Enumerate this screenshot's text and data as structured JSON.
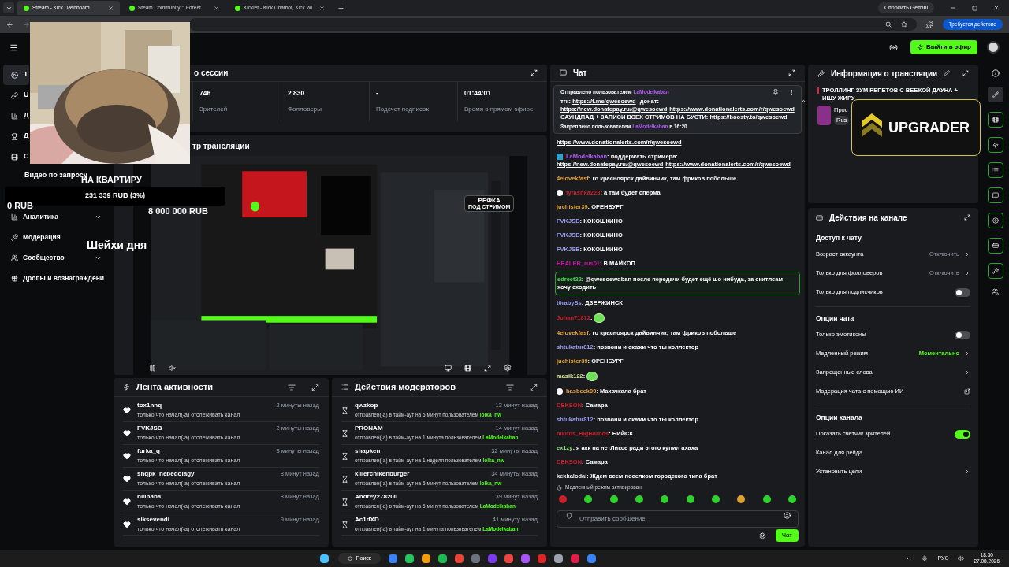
{
  "browser": {
    "tabs": [
      {
        "title": "Stream - Kick Dashboard",
        "selected": true
      },
      {
        "title": "Steam Community :: Edreet",
        "selected": false
      },
      {
        "title": "Kicklet - Kick Chatbot, Kick Wi",
        "selected": false
      }
    ],
    "gemini": "Спросить Gemini",
    "action": "Требуется действие"
  },
  "header": {
    "go_live": "Выйти в эфир"
  },
  "sidebar": {
    "items": [
      {
        "label": "Т",
        "selected": true
      },
      {
        "label": "U",
        "selected": false
      },
      {
        "label": "Д",
        "selected": false
      },
      {
        "label": "Д",
        "selected": false
      },
      {
        "label": "С",
        "selected": false
      }
    ],
    "lower_items": [
      {
        "label": "Аналитика",
        "selected": false,
        "expandable": true
      },
      {
        "label": "Модерация",
        "selected": false,
        "expandable": false
      },
      {
        "label": "Сообщество",
        "selected": false,
        "expandable": true
      },
      {
        "label": "Дропы и вознаграждени",
        "selected": false,
        "expandable": false
      }
    ]
  },
  "session": {
    "title": "о сессии",
    "stats": [
      {
        "value": "746",
        "label": "Зрителей"
      },
      {
        "value": "2 830",
        "label": "Фолловеры"
      },
      {
        "value": "-",
        "label": "Подсчет подписок"
      },
      {
        "value": "01:44:01",
        "label": "Время в прямом эфире"
      }
    ]
  },
  "preview": {
    "title": "тр трансляции",
    "badge_line_1": "РЕФКА",
    "badge_line_2": "ПОД СТРИМОМ"
  },
  "activity": {
    "title": "Лента активности",
    "items": [
      {
        "user": "tox1nnq",
        "time": "2 минуты назад",
        "text": "только что начал(-а) отслеживать канал"
      },
      {
        "user": "FVKJSB",
        "time": "2 минуты назад",
        "text": "только что начал(-а) отслеживать канал"
      },
      {
        "user": "furka_q",
        "time": "3 минуты назад",
        "text": "только что начал(-а) отслеживать канал"
      },
      {
        "user": "snqpk_nebedolagy",
        "time": "8 минут назад",
        "text": "только что начал(-а) отслеживать канал"
      },
      {
        "user": "bilibaba",
        "time": "8 минут назад",
        "text": "только что начал(-а) отслеживать канал"
      },
      {
        "user": "siksevendi",
        "time": "9 минут назад",
        "text": "только что начал(-а) отслеживать канал"
      }
    ]
  },
  "mod_actions": {
    "title": "Действия модераторов",
    "items": [
      {
        "user": "qwzkop",
        "time": "13 минут назад",
        "text": "отправлен(-а) в тайм-аут на 5 минут пользователем",
        "moderator": "lolka_nw"
      },
      {
        "user": "PRONAM",
        "time": "14 минут назад",
        "text": "отправлен(-а) в тайм-аут на 1 минута пользователем",
        "moderator": "LaModelkaban"
      },
      {
        "user": "shapken",
        "time": "32 минуты назад",
        "text": "отправлен(-а) в тайм-аут на 1 неделя пользователем",
        "moderator": "lolka_nw"
      },
      {
        "user": "killerchikenburger",
        "time": "34 минуты назад",
        "text": "отправлен(-а) в тайм-аут на 5 минут пользователем",
        "moderator": "lolka_nw"
      },
      {
        "user": "Andrey278200",
        "time": "39 минут назад",
        "text": "отправлен(-а) в тайм-аут на 5 минут пользователем",
        "moderator": "LaModelkaban"
      },
      {
        "user": "Ac1dXD",
        "time": "41 минуту назад",
        "text": "отправлен(-а) в тайм-аут на 1 минута пользователем",
        "moderator": "LaModelkaban"
      }
    ]
  },
  "chat": {
    "title": "Чат",
    "pinned": {
      "sender_label": "Отправлено пользователем",
      "sender": "LaModelkaban",
      "body": [
        {
          "text": "тгк: ",
          "link": false
        },
        {
          "text": "https://t.me/qwesoewd",
          "link": true
        },
        {
          "text": " донат: ",
          "link": false
        },
        {
          "text": "https://new.donatepay.ru/@qwesoewd",
          "link": true
        },
        {
          "text": "https://www.donationalerts.com/r/qwesoewd",
          "link": true
        },
        {
          "text": " САУНДПАД + ЗАПИСИ ВСЕХ СТРИМОВ НА БУСТИ: ",
          "link": false
        },
        {
          "text": "https://boosty.to/qwesoewd",
          "link": true
        }
      ],
      "footer_label": "Закреплено пользователем",
      "footer_user": "LaModelkaban",
      "footer_time": "в 16:20"
    },
    "messages": [
      {
        "kind": "links",
        "moderator": false,
        "badge": false,
        "highlighted": false,
        "body": [
          {
            "text": "https://www.donationalerts.com/r/qwesoewd",
            "link": true
          }
        ]
      },
      {
        "kind": "links",
        "user": "LaModelkaban",
        "color": "#b05cf0",
        "moderator": true,
        "badge": false,
        "highlighted": false,
        "body": [
          {
            "text": ": поддержать стримера: ",
            "link": false
          },
          {
            "text": "https://new.donatepay.ru/@qwesoewd",
            "link": true
          },
          {
            "text": "https://www.donationalerts.com/r/qwesoewd",
            "link": true
          }
        ]
      },
      {
        "kind": "text",
        "user": "4elovekfasf",
        "color": "#e8a33c",
        "moderator": false,
        "badge": false,
        "highlighted": false,
        "text": ": го красноярск дайвинчик, там фриков побольше"
      },
      {
        "kind": "text",
        "user": "fyrashka228",
        "color": "#c8202c",
        "moderator": false,
        "badge": true,
        "highlighted": false,
        "text": ": а там будет сперма"
      },
      {
        "kind": "text",
        "user": "juchister39",
        "color": "#e0a030",
        "moderator": false,
        "badge": false,
        "highlighted": false,
        "text": ": ОРЕНБУРГ"
      },
      {
        "kind": "text",
        "user": "FVKJSB",
        "color": "#9a9cf0",
        "moderator": false,
        "badge": false,
        "highlighted": false,
        "text": ": КОКОШКИНО"
      },
      {
        "kind": "text",
        "user": "FVKJSB",
        "color": "#9a9cf0",
        "moderator": false,
        "badge": false,
        "highlighted": false,
        "text": ": КОКОШКИНО"
      },
      {
        "kind": "text",
        "user": "FVKJSB",
        "color": "#9a9cf0",
        "moderator": false,
        "badge": false,
        "highlighted": false,
        "text": ": КОКОШКИНО"
      },
      {
        "kind": "text",
        "user": "HEALER_rus01",
        "color": "#c2189c",
        "moderator": false,
        "badge": false,
        "highlighted": false,
        "text": ": В МАЙКОП"
      },
      {
        "kind": "text",
        "user": "edreet22",
        "color": "#3ee04a",
        "moderator": false,
        "badge": false,
        "highlighted": true,
        "text": ": @qwesoewdban после передачи будет ещё шо нибудь, за скитлсам хочу сходить"
      },
      {
        "kind": "text",
        "user": "t0rabySs",
        "color": "#9a9cf0",
        "moderator": false,
        "badge": false,
        "highlighted": false,
        "text": ": ДЗЕРЖИНСК"
      },
      {
        "kind": "emote",
        "user": "Johan71872",
        "color": "#c8202c",
        "moderator": false,
        "badge": false,
        "highlighted": false,
        "text": ":"
      },
      {
        "kind": "text",
        "user": "4elovekfasf",
        "color": "#e8a33c",
        "moderator": false,
        "badge": false,
        "highlighted": false,
        "text": ": го красноярск дайвинчик, там фриков побольше"
      },
      {
        "kind": "text",
        "user": "shtukatur812",
        "color": "#9a9cf0",
        "moderator": false,
        "badge": false,
        "highlighted": false,
        "text": ": позвони и скажи что ты коллектор"
      },
      {
        "kind": "text",
        "user": "juchister39",
        "color": "#e0a030",
        "moderator": false,
        "badge": false,
        "highlighted": false,
        "text": ": ОРЕНБУРГ"
      },
      {
        "kind": "emote",
        "user": "masik122",
        "color": "#d8e89a",
        "moderator": false,
        "badge": false,
        "highlighted": false,
        "text": ":"
      },
      {
        "kind": "text",
        "user": "hasbeek00",
        "color": "#e8a33c",
        "moderator": false,
        "badge": true,
        "highlighted": false,
        "text": ": Махачкала брат"
      },
      {
        "kind": "text",
        "user": "DEKSON",
        "color": "#c8202c",
        "moderator": false,
        "badge": false,
        "highlighted": false,
        "text": ": Самара"
      },
      {
        "kind": "text",
        "user": "shtukatur812",
        "color": "#9a9cf0",
        "moderator": false,
        "badge": false,
        "highlighted": false,
        "text": ": позвони и скажи что ты коллектор"
      },
      {
        "kind": "text",
        "user": "nikitos_BigBarbos",
        "color": "#c8202c",
        "moderator": false,
        "badge": false,
        "highlighted": false,
        "text": ": БИЙСК"
      },
      {
        "kind": "text",
        "user": "ex1zy",
        "color": "#8ee07a",
        "moderator": false,
        "badge": false,
        "highlighted": false,
        "text": ": я акк на нетЛиксе ради этого купил ахаха"
      },
      {
        "kind": "text",
        "user": "DEKSON",
        "color": "#c8202c",
        "moderator": false,
        "badge": false,
        "highlighted": false,
        "text": ": Самара"
      },
      {
        "kind": "text",
        "user": "kekkalodai",
        "color": "#f0f0f0",
        "moderator": false,
        "badge": false,
        "highlighted": false,
        "text": ": Ждем всем поселком городского типа брат"
      }
    ],
    "slow_mode": "Медленный режим активирован",
    "placeholder": "Отправить сообщение",
    "send": "Чат"
  },
  "stream_info": {
    "title": "Информация о трансляции",
    "stream_title": "ТРОЛЛИНГ ЗУМ РЕПЕТОВ С ВЕБКОЙ ДАУНА + ИЩУ ЖИРУ",
    "category": "Прос",
    "language": "Rus"
  },
  "channel_actions": {
    "title": "Действия на канале",
    "sections": [
      {
        "title": "Доступ к чату",
        "rows": [
          {
            "kind": "chevron",
            "label": "Возраст аккаунта",
            "value": "Отключить",
            "active": false
          },
          {
            "kind": "chevron",
            "label": "Только для фолловеров",
            "value": "Отключить",
            "active": false
          },
          {
            "kind": "toggle",
            "label": "Только для подписчиков",
            "on": false
          }
        ]
      },
      {
        "title": "Опции чата",
        "rows": [
          {
            "kind": "toggle",
            "label": "Только эмотиконы",
            "on": false
          },
          {
            "kind": "chevron",
            "label": "Медленный режим",
            "value": "Моментально",
            "active": true
          },
          {
            "kind": "chevron",
            "label": "Запрещенные слова"
          },
          {
            "kind": "external",
            "label": "Модерация чата с помощью ИИ"
          }
        ]
      },
      {
        "title": "Опции канала",
        "rows": [
          {
            "kind": "toggle",
            "label": "Показать счетчик зрителей",
            "on": true
          },
          {
            "kind": "plain",
            "label": "Канал для рейда"
          },
          {
            "kind": "chevron",
            "label": "Установить цели"
          }
        ]
      }
    ]
  },
  "overlays": {
    "video_request": "Видео по запросу",
    "goal_title": "НА КВАРТИРУ",
    "goal_progress": "231 339 RUB (3%)",
    "goal_start": "0 RUB",
    "goal_target": "8 000 000 RUB",
    "sheikhs": "Шейхи дня",
    "upgrader": "UPGRADER"
  },
  "taskbar": {
    "search": "Поиск",
    "lang": "РУС",
    "time": "18:30",
    "date": "27.08.2026"
  }
}
